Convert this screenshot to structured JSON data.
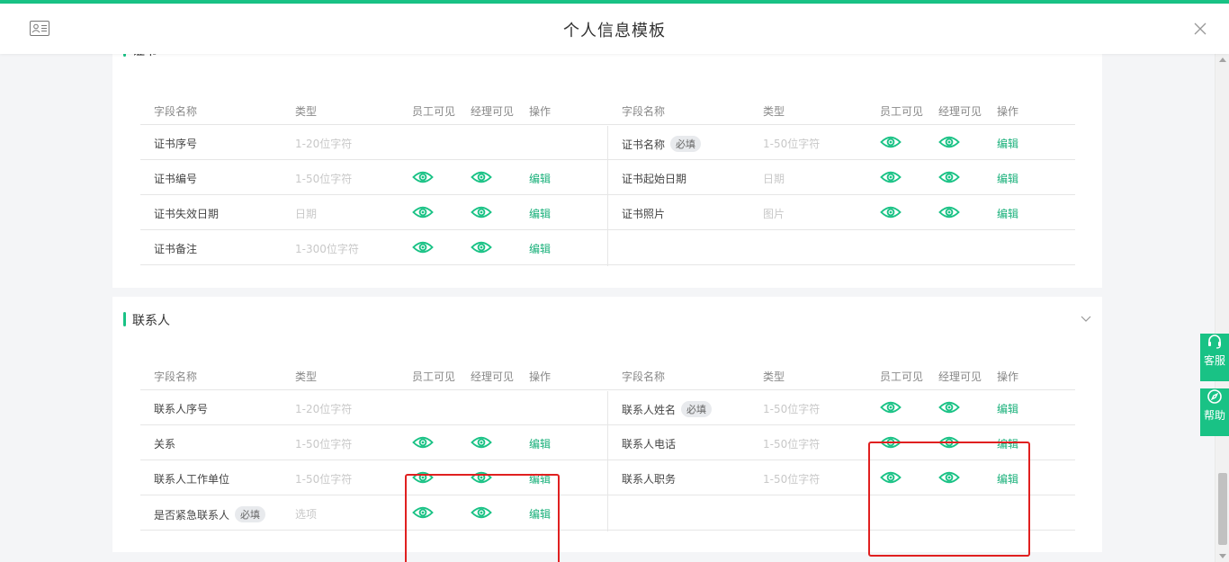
{
  "header": {
    "title": "个人信息模板"
  },
  "icons": {
    "header_left": "id-card-icon",
    "close": "close-icon",
    "collapse": "chevron-down-icon",
    "visible": "eye-icon"
  },
  "colors": {
    "accent": "#19c285",
    "link": "#19b07a",
    "highlight": "#e02020"
  },
  "columns": [
    "字段名称",
    "类型",
    "员工可见",
    "经理可见",
    "操作"
  ],
  "required_badge": "必填",
  "edit_label": "编辑",
  "sections": {
    "certificate": {
      "title": "证书",
      "left": [
        {
          "name": "证书序号",
          "type": "1-20位字符"
        },
        {
          "name": "证书编号",
          "type": "1-50位字符"
        },
        {
          "name": "证书失效日期",
          "type": "日期"
        },
        {
          "name": "证书备注",
          "type": "1-300位字符"
        }
      ],
      "right": [
        {
          "name": "证书名称",
          "type": "1-50位字符"
        },
        {
          "name": "证书起始日期",
          "type": "日期"
        },
        {
          "name": "证书照片",
          "type": "图片"
        }
      ]
    },
    "contact": {
      "title": "联系人",
      "left": [
        {
          "name": "联系人序号",
          "type": "1-20位字符"
        },
        {
          "name": "关系",
          "type": "1-50位字符"
        },
        {
          "name": "联系人工作单位",
          "type": "1-50位字符"
        },
        {
          "name": "是否紧急联系人",
          "type": "选项"
        }
      ],
      "right": [
        {
          "name": "联系人姓名",
          "type": "1-50位字符"
        },
        {
          "name": "联系人电话",
          "type": "1-50位字符"
        },
        {
          "name": "联系人职务",
          "type": "1-50位字符"
        }
      ]
    }
  },
  "side": {
    "service": "客服",
    "help": "帮助"
  }
}
